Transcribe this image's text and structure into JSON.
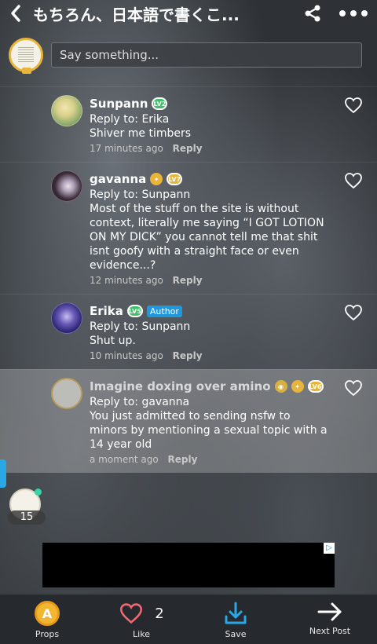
{
  "header": {
    "title": "もちろん、日本語で書くこ..."
  },
  "composer": {
    "placeholder": "Say something..."
  },
  "comments": [
    {
      "name": "Sunpann",
      "level": "LV2",
      "author": "",
      "reply_to": "Reply to: Erika",
      "text": "Shiver me timbers",
      "time": "17 minutes ago",
      "reply_label": "Reply",
      "level_color": "#3fbf6a"
    },
    {
      "name": "gavanna",
      "level": "LV7",
      "author": "",
      "reply_to": "Reply to: Sunpann",
      "text": "Most of the stuff on the site is without context, literally me saying “I GOT LOTION ON MY DICK” you cannot tell me that shit isnt goofy with a straight face or even evidence...?",
      "time": "12 minutes ago",
      "reply_label": "Reply",
      "level_color": "#e8b53a"
    },
    {
      "name": "Erika",
      "level": "LV5",
      "author": "Author",
      "reply_to": "Reply to: Sunpann",
      "text": "Shut up.",
      "time": "10 minutes ago",
      "reply_label": "Reply",
      "level_color": "#3fbf6a"
    },
    {
      "name": "Imagine doxing over amino",
      "level": "LV6",
      "author": "",
      "reply_to": "Reply to: gavanna",
      "text": "You just admitted to sending nsfw to minors by mentioning a sexual topic with a 14 year old",
      "time": "a moment ago",
      "reply_label": "Reply",
      "level_color": "#e8b53a"
    }
  ],
  "online": {
    "count": "15"
  },
  "toolbar": {
    "props_label": "Props",
    "props_glyph": "A",
    "like_label": "Like",
    "like_count": "2",
    "save_label": "Save",
    "next_label": "Next Post"
  },
  "colors": {
    "accent_blue": "#1f98dc",
    "like_red": "#f06a74",
    "save_blue": "#2aa8e6",
    "coin_gold": "#f2b632"
  },
  "icons": [
    "back-icon",
    "share-icon",
    "more-icon",
    "heart-icon",
    "download-icon",
    "arrow-right-icon",
    "ad-choices-icon"
  ]
}
